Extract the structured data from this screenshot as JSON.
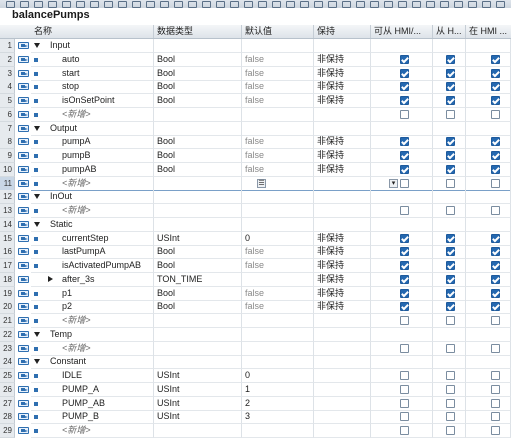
{
  "block_title": "balancePumps",
  "columns": {
    "name": "名称",
    "datatype": "数据类型",
    "default": "默认值",
    "retain": "保持",
    "hmi_access": "可从 HMI/...",
    "hmi_write": "从 H...",
    "hmi_visible": "在 HMI ..."
  },
  "rows": [
    {
      "num": "1",
      "level": 0,
      "type": "section",
      "name": "Input",
      "expander": "open",
      "datatype": "",
      "default": "",
      "retain": "",
      "cb": [
        0,
        0,
        0
      ]
    },
    {
      "num": "2",
      "level": 1,
      "type": "var",
      "name": "auto",
      "datatype": "Bool",
      "default": "false",
      "retain": "非保持",
      "cb": [
        1,
        1,
        1
      ]
    },
    {
      "num": "3",
      "level": 1,
      "type": "var",
      "name": "start",
      "datatype": "Bool",
      "default": "false",
      "retain": "非保持",
      "cb": [
        1,
        1,
        1
      ]
    },
    {
      "num": "4",
      "level": 1,
      "type": "var",
      "name": "stop",
      "datatype": "Bool",
      "default": "false",
      "retain": "非保持",
      "cb": [
        1,
        1,
        1
      ]
    },
    {
      "num": "5",
      "level": 1,
      "type": "var",
      "name": "isOnSetPoint",
      "datatype": "Bool",
      "default": "false",
      "retain": "非保持",
      "cb": [
        1,
        1,
        1
      ]
    },
    {
      "num": "6",
      "level": 1,
      "type": "new",
      "name": "<新增>",
      "datatype": "",
      "default": "",
      "retain": "",
      "cb": [
        0,
        0,
        0
      ]
    },
    {
      "num": "7",
      "level": 0,
      "type": "section",
      "name": "Output",
      "expander": "open",
      "datatype": "",
      "default": "",
      "retain": "",
      "cb": [
        0,
        0,
        0
      ]
    },
    {
      "num": "8",
      "level": 1,
      "type": "var",
      "name": "pumpA",
      "datatype": "Bool",
      "default": "false",
      "retain": "非保持",
      "cb": [
        1,
        1,
        1
      ]
    },
    {
      "num": "9",
      "level": 1,
      "type": "var",
      "name": "pumpB",
      "datatype": "Bool",
      "default": "false",
      "retain": "非保持",
      "cb": [
        1,
        1,
        1
      ]
    },
    {
      "num": "10",
      "level": 1,
      "type": "var",
      "name": "pumpAB",
      "datatype": "Bool",
      "default": "false",
      "retain": "非保持",
      "cb": [
        1,
        1,
        1
      ]
    },
    {
      "num": "11",
      "level": 1,
      "type": "editing",
      "name": "<新增>",
      "datatype": "",
      "default": "",
      "retain": "",
      "cb": [
        0,
        0,
        0
      ]
    },
    {
      "num": "12",
      "level": 0,
      "type": "section",
      "name": "InOut",
      "expander": "open",
      "datatype": "",
      "default": "",
      "retain": "",
      "cb": [
        0,
        0,
        0
      ]
    },
    {
      "num": "13",
      "level": 1,
      "type": "new",
      "name": "<新增>",
      "datatype": "",
      "default": "",
      "retain": "",
      "cb": [
        0,
        0,
        0
      ]
    },
    {
      "num": "14",
      "level": 0,
      "type": "section",
      "name": "Static",
      "expander": "open",
      "datatype": "",
      "default": "",
      "retain": "",
      "cb": [
        0,
        0,
        0
      ]
    },
    {
      "num": "15",
      "level": 1,
      "type": "var",
      "name": "currentStep",
      "datatype": "USInt",
      "default": "0",
      "retain": "非保持",
      "cb": [
        1,
        1,
        1
      ]
    },
    {
      "num": "16",
      "level": 1,
      "type": "var",
      "name": "lastPumpA",
      "datatype": "Bool",
      "default": "false",
      "retain": "非保持",
      "cb": [
        1,
        1,
        1
      ]
    },
    {
      "num": "17",
      "level": 1,
      "type": "var",
      "name": "isActivatedPumpAB",
      "datatype": "Bool",
      "default": "false",
      "retain": "非保持",
      "cb": [
        1,
        1,
        1
      ]
    },
    {
      "num": "18",
      "level": 1,
      "type": "varexp",
      "name": "after_3s",
      "datatype": "TON_TIME",
      "default": "",
      "retain": "非保持",
      "cb": [
        1,
        1,
        1
      ]
    },
    {
      "num": "19",
      "level": 1,
      "type": "var",
      "name": "p1",
      "datatype": "Bool",
      "default": "false",
      "retain": "非保持",
      "cb": [
        1,
        1,
        1
      ]
    },
    {
      "num": "20",
      "level": 1,
      "type": "var",
      "name": "p2",
      "datatype": "Bool",
      "default": "false",
      "retain": "非保持",
      "cb": [
        1,
        1,
        1
      ]
    },
    {
      "num": "21",
      "level": 1,
      "type": "new",
      "name": "<新增>",
      "datatype": "",
      "default": "",
      "retain": "",
      "cb": [
        0,
        0,
        0
      ]
    },
    {
      "num": "22",
      "level": 0,
      "type": "section",
      "name": "Temp",
      "expander": "open",
      "datatype": "",
      "default": "",
      "retain": "",
      "cb": [
        0,
        0,
        0
      ]
    },
    {
      "num": "23",
      "level": 1,
      "type": "new",
      "name": "<新增>",
      "datatype": "",
      "default": "",
      "retain": "",
      "cb": [
        0,
        0,
        0
      ]
    },
    {
      "num": "24",
      "level": 0,
      "type": "section",
      "name": "Constant",
      "expander": "open",
      "datatype": "",
      "default": "",
      "retain": "",
      "cb": [
        0,
        0,
        0
      ]
    },
    {
      "num": "25",
      "level": 1,
      "type": "var",
      "name": "IDLE",
      "datatype": "USInt",
      "default": "0",
      "retain": "",
      "cb": [
        0,
        0,
        0
      ]
    },
    {
      "num": "26",
      "level": 1,
      "type": "var",
      "name": "PUMP_A",
      "datatype": "USInt",
      "default": "1",
      "retain": "",
      "cb": [
        0,
        0,
        0
      ]
    },
    {
      "num": "27",
      "level": 1,
      "type": "var",
      "name": "PUMP_AB",
      "datatype": "USInt",
      "default": "2",
      "retain": "",
      "cb": [
        0,
        0,
        0
      ]
    },
    {
      "num": "28",
      "level": 1,
      "type": "var",
      "name": "PUMP_B",
      "datatype": "USInt",
      "default": "3",
      "retain": "",
      "cb": [
        0,
        0,
        0
      ]
    },
    {
      "num": "29",
      "level": 1,
      "type": "new",
      "name": "<新增>",
      "datatype": "",
      "default": "",
      "retain": "",
      "cb": [
        0,
        0,
        0
      ]
    }
  ]
}
